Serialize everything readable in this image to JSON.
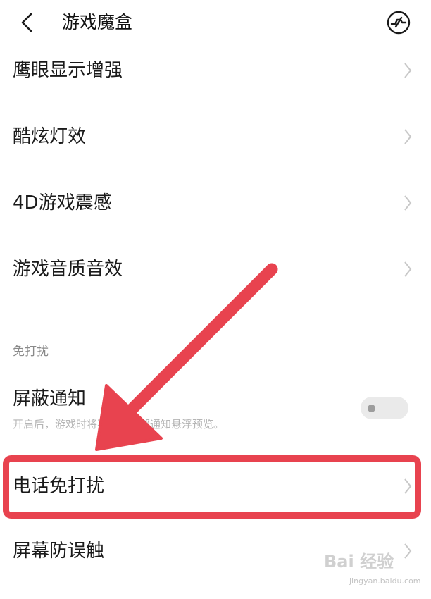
{
  "header": {
    "title": "游戏魔盒",
    "back_icon": "back-chevron-icon",
    "action_icon": "gamepad-icon"
  },
  "settings_rows": [
    {
      "label": "鹰眼显示增强"
    },
    {
      "label": "酷炫灯效"
    },
    {
      "label": "4D游戏震感"
    },
    {
      "label": "游戏音质音效"
    }
  ],
  "do_not_disturb": {
    "section_title": "免打扰",
    "block_notifications": {
      "label": "屏蔽通知",
      "description": "开启后，游戏时将不显示顶部通知悬浮预览。",
      "enabled": false
    },
    "rows": [
      {
        "label": "电话免打扰"
      },
      {
        "label": "屏幕防误触"
      }
    ]
  },
  "annotation": {
    "highlight_color": "#e8434f",
    "highlighted_item": "电话免打扰"
  },
  "watermark": {
    "brand": "Bai 经验",
    "url": "jingyan.baidu.com"
  },
  "colors": {
    "text": "#1a1a1a",
    "muted": "#8a8a8a",
    "chevron": "#c8c8c8",
    "toggle_track": "#eaeaea"
  }
}
